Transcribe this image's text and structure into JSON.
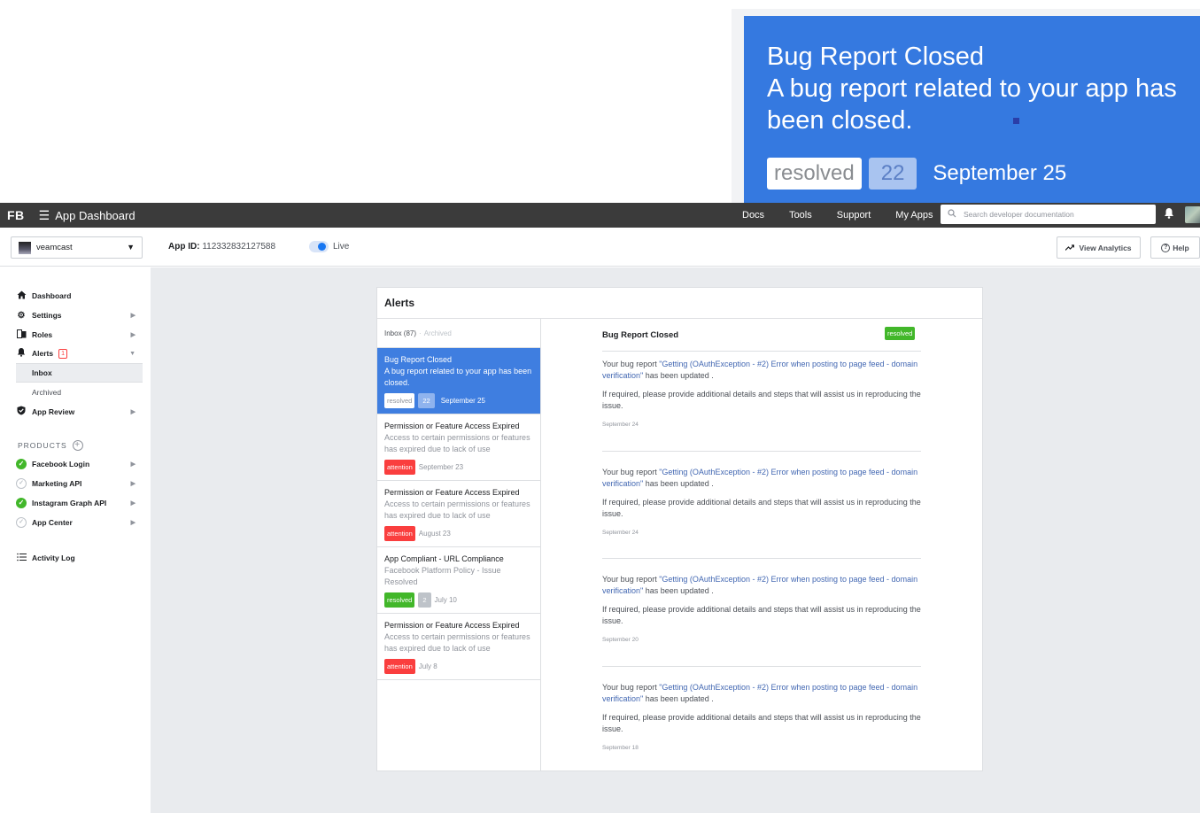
{
  "zoom": {
    "title": "Bug Report Closed",
    "desc": "A bug report related to your app has been closed.",
    "badge": "resolved",
    "count": "22",
    "date": "September 25"
  },
  "topbar": {
    "logo": "FB",
    "menu_icon": "menu-icon",
    "title": "App Dashboard",
    "nav": [
      "Docs",
      "Tools",
      "Support",
      "My Apps"
    ],
    "search_placeholder": "Search developer documentation"
  },
  "subbar": {
    "app_name": "veamcast",
    "app_id_label": "App ID:",
    "app_id": "112332832127588",
    "live_label": "Live",
    "analytics_label": "View Analytics",
    "help_label": "Help"
  },
  "sidebar": {
    "items": [
      {
        "label": "Dashboard",
        "icon": "home-icon"
      },
      {
        "label": "Settings",
        "icon": "gear-icon"
      },
      {
        "label": "Roles",
        "icon": "roles-icon"
      },
      {
        "label": "Alerts",
        "icon": "bell-icon",
        "badge": "1"
      },
      {
        "label": "App Review",
        "icon": "shield-icon"
      }
    ],
    "sub": [
      "Inbox",
      "Archived"
    ],
    "products_label": "PRODUCTS",
    "products": [
      {
        "label": "Facebook Login",
        "status": "active"
      },
      {
        "label": "Marketing API",
        "status": "inactive"
      },
      {
        "label": "Instagram Graph API",
        "status": "active"
      },
      {
        "label": "App Center",
        "status": "inactive"
      }
    ],
    "activity": "Activity Log"
  },
  "alerts": {
    "title": "Alerts",
    "inbox_tab": "Inbox (87)",
    "separator": "·",
    "archived_tab": "Archived",
    "list": [
      {
        "title": "Bug Report Closed",
        "desc": "A bug report related to your app has been closed.",
        "badge": "resolved",
        "count": "22",
        "date": "September 25"
      },
      {
        "title": "Permission or Feature Access Expired",
        "desc": "Access to certain permissions or features has expired due to lack of use",
        "badge": "attention",
        "date": "September 23"
      },
      {
        "title": "Permission or Feature Access Expired",
        "desc": "Access to certain permissions or features has expired due to lack of use",
        "badge": "attention",
        "date": "August 23"
      },
      {
        "title": "App Compliant - URL Compliance",
        "desc": "Facebook Platform Policy - Issue Resolved",
        "badge": "resolved",
        "count": "2",
        "date": "July 10"
      },
      {
        "title": "Permission or Feature Access Expired",
        "desc": "Access to certain permissions or features has expired due to lack of use",
        "badge": "attention",
        "date": "July 8"
      }
    ],
    "detail": {
      "title": "Bug Report Closed",
      "badge": "resolved",
      "entries": [
        {
          "pre": "Your bug report ",
          "link": "\"Getting (OAuthException - #2) Error when posting to page feed - domain verification\"",
          "post": " has been updated .",
          "note": "If required, please provide additional details and steps that will assist us in reproducing the issue.",
          "date": "September 24"
        },
        {
          "pre": "Your bug report ",
          "link": "\"Getting (OAuthException - #2) Error when posting to page feed - domain verification\"",
          "post": " has been updated .",
          "note": "If required, please provide additional details and steps that will assist us in reproducing the issue.",
          "date": "September 24"
        },
        {
          "pre": "Your bug report ",
          "link": "\"Getting (OAuthException - #2) Error when posting to page feed - domain verification\"",
          "post": " has been updated .",
          "note": "If required, please provide additional details and steps that will assist us in reproducing the issue.",
          "date": "September 20"
        },
        {
          "pre": "Your bug report ",
          "link": "\"Getting (OAuthException - #2) Error when posting to page feed - domain verification\"",
          "post": " has been updated .",
          "note": "If required, please provide additional details and steps that will assist us in reproducing the issue.",
          "date": "September 18"
        }
      ]
    }
  }
}
